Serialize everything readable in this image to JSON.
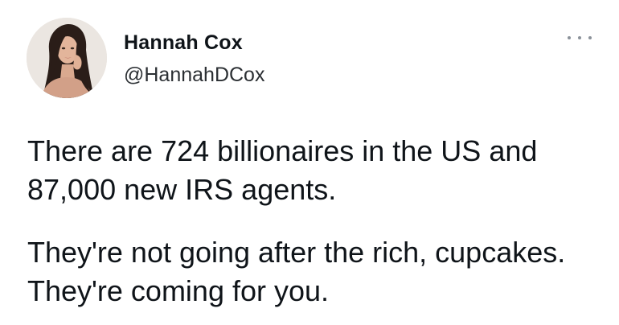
{
  "author": {
    "display_name": "Hannah Cox",
    "handle": "@HannahDCox",
    "avatar": "profile-photo"
  },
  "menu": {
    "icon": "more-horizontal-icon"
  },
  "tweet": {
    "paragraphs": [
      "There are 724 billionaires in the US and 87,000 new IRS agents.",
      "They're not going after the rich, cupcakes. They're coming for you."
    ]
  }
}
